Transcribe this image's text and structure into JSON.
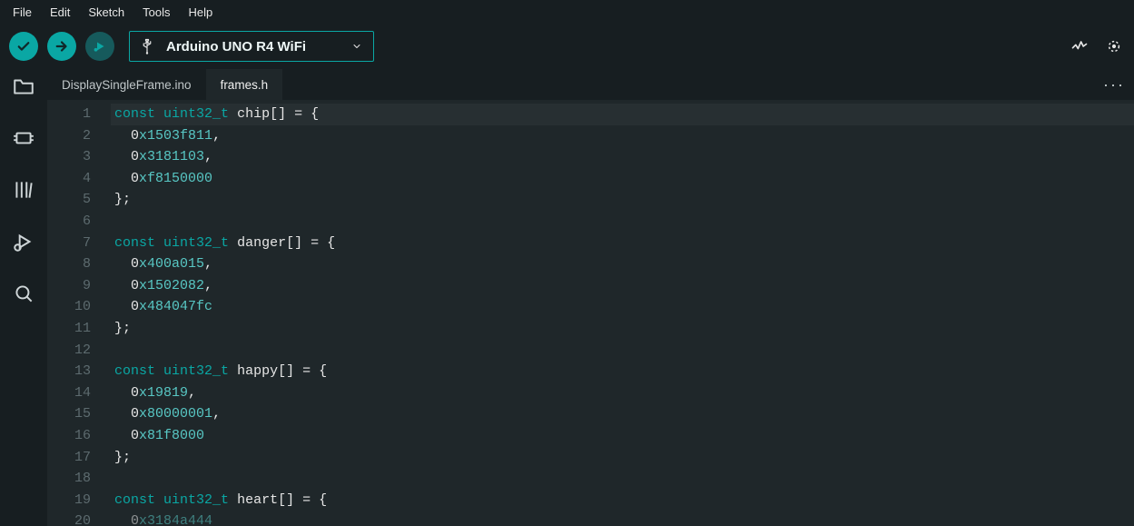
{
  "menu": {
    "items": [
      "File",
      "Edit",
      "Sketch",
      "Tools",
      "Help"
    ]
  },
  "toolbar": {
    "board_label": "Arduino UNO R4 WiFi"
  },
  "tabs": {
    "items": [
      {
        "label": "DisplaySingleFrame.ino",
        "active": false
      },
      {
        "label": "frames.h",
        "active": true
      }
    ]
  },
  "editor": {
    "line_numbers": [
      1,
      2,
      3,
      4,
      5,
      6,
      7,
      8,
      9,
      10,
      11,
      12,
      13,
      14,
      15,
      16,
      17,
      18,
      19,
      20
    ],
    "code": [
      {
        "t": "decl",
        "kw": "const",
        "type": "uint32_t",
        "name": "chip",
        "rest": "[] = {",
        "hl": true
      },
      {
        "t": "hex",
        "zero": "0",
        "x": "x",
        "digits": "1503f811",
        "comma": ","
      },
      {
        "t": "hex",
        "zero": "0",
        "x": "x",
        "digits": "3181103",
        "comma": ","
      },
      {
        "t": "hex",
        "zero": "0",
        "x": "x",
        "digits": "f8150000",
        "comma": ""
      },
      {
        "t": "close"
      },
      {
        "t": "blank"
      },
      {
        "t": "decl",
        "kw": "const",
        "type": "uint32_t",
        "name": "danger",
        "rest": "[] = {"
      },
      {
        "t": "hex",
        "zero": "0",
        "x": "x",
        "digits": "400a015",
        "comma": ","
      },
      {
        "t": "hex",
        "zero": "0",
        "x": "x",
        "digits": "1502082",
        "comma": ","
      },
      {
        "t": "hex",
        "zero": "0",
        "x": "x",
        "digits": "484047fc",
        "comma": ""
      },
      {
        "t": "close"
      },
      {
        "t": "blank"
      },
      {
        "t": "decl",
        "kw": "const",
        "type": "uint32_t",
        "name": "happy",
        "rest": "[] = {"
      },
      {
        "t": "hex",
        "zero": "0",
        "x": "x",
        "digits": "19819",
        "comma": ","
      },
      {
        "t": "hex",
        "zero": "0",
        "x": "x",
        "digits": "80000001",
        "comma": ","
      },
      {
        "t": "hex",
        "zero": "0",
        "x": "x",
        "digits": "81f8000",
        "comma": ""
      },
      {
        "t": "close"
      },
      {
        "t": "blank"
      },
      {
        "t": "decl",
        "kw": "const",
        "type": "uint32_t",
        "name": "heart",
        "rest": "[] = {"
      },
      {
        "t": "hex",
        "zero": "0",
        "x": "x",
        "digits": "3184a444",
        "comma": "",
        "faded": true
      }
    ]
  }
}
